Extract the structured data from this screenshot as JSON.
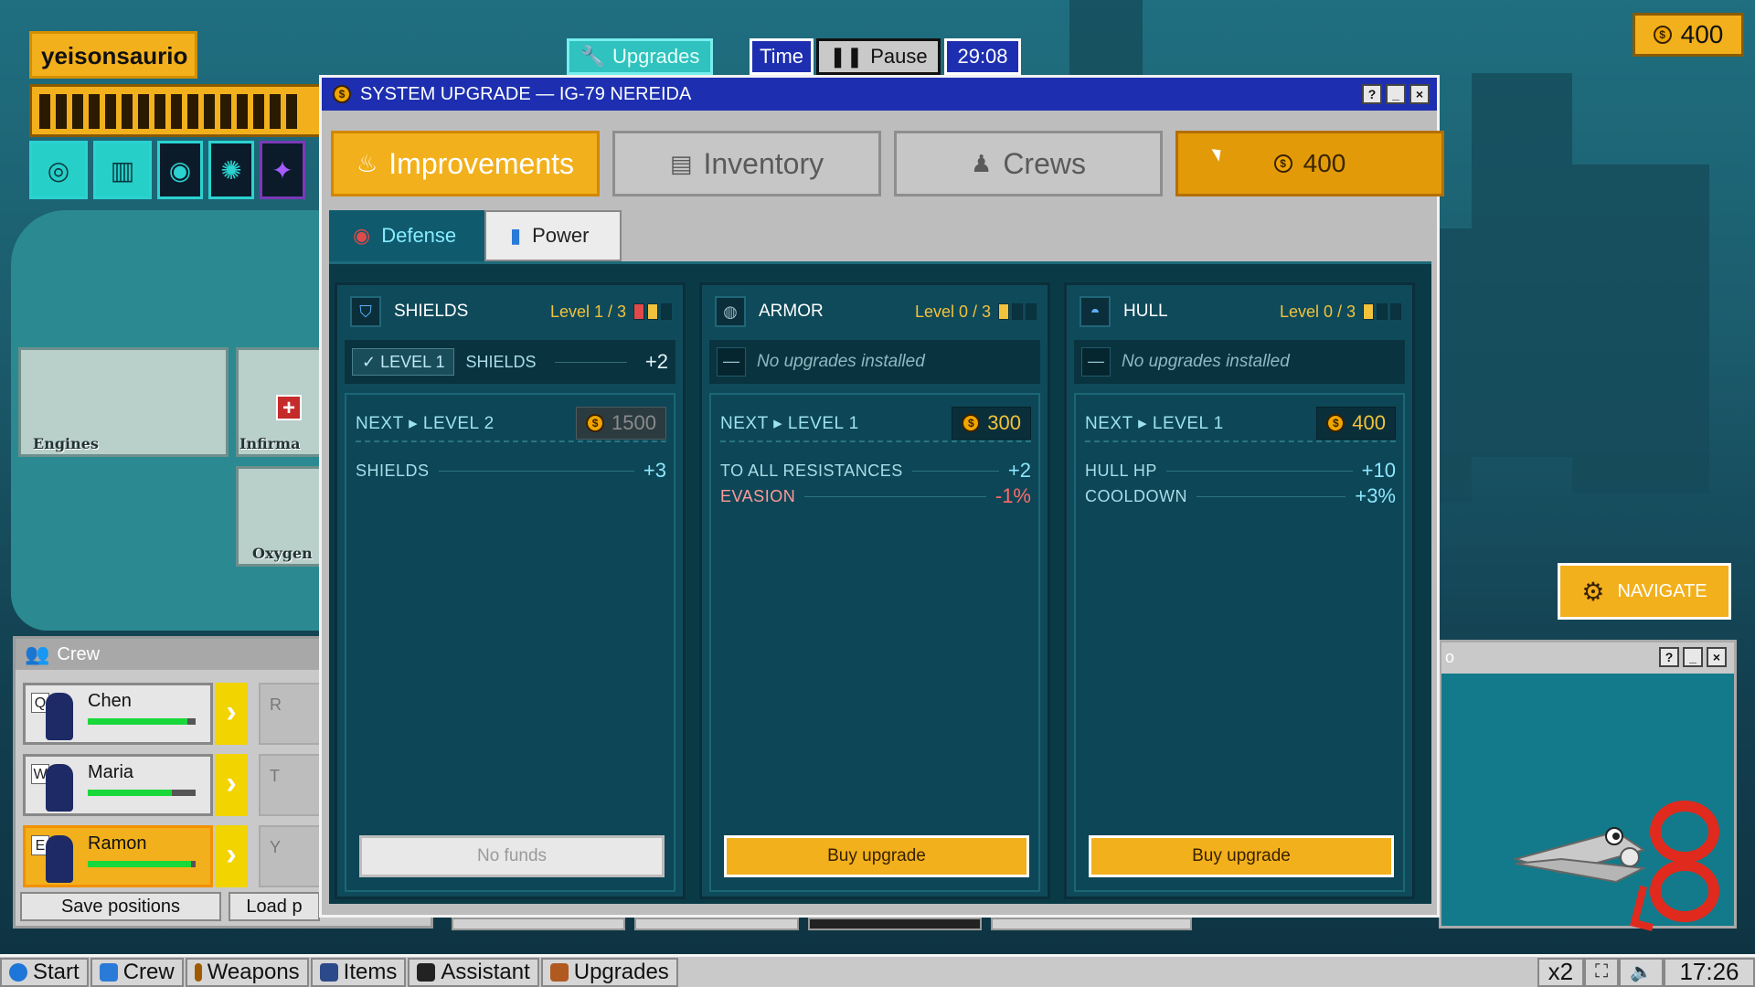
{
  "hud": {
    "player_name": "yeisonsaurio",
    "hp_segments": 16,
    "tabs": {
      "upgrades": "Upgrades",
      "time": "Time",
      "pause": "Pause",
      "clock": "29:08"
    },
    "coins": "400"
  },
  "scene": {
    "rooms": [
      "Engines",
      "Infirma",
      "Oxygen"
    ]
  },
  "dialog": {
    "title": "SYSTEM UPGRADE — IG-79 NEREIDA",
    "win_buttons": [
      "?",
      "_",
      "×"
    ],
    "main_tabs": [
      "Improvements",
      "Inventory",
      "Crews"
    ],
    "coins": "400",
    "sub_tabs": [
      "Defense",
      "Power"
    ]
  },
  "cards": [
    {
      "name": "SHIELDS",
      "level": "Level 1 / 3",
      "installed": {
        "badge": "✓ LEVEL 1",
        "name": "SHIELDS",
        "value": "+2"
      },
      "next_label": "NEXT ▸ LEVEL 2",
      "price": "1500",
      "stats": [
        {
          "name": "SHIELDS",
          "value": "+3",
          "negative": false
        }
      ],
      "button": "No funds"
    },
    {
      "name": "ARMOR",
      "level": "Level 0 / 3",
      "none_text": "No upgrades installed",
      "next_label": "NEXT ▸ LEVEL 1",
      "price": "300",
      "stats": [
        {
          "name": "TO ALL RESISTANCES",
          "value": "+2",
          "negative": false
        },
        {
          "name": "EVASION",
          "value": "-1%",
          "negative": true
        }
      ],
      "button": "Buy upgrade"
    },
    {
      "name": "HULL",
      "level": "Level 0 / 3",
      "none_text": "No upgrades installed",
      "next_label": "NEXT ▸ LEVEL 1",
      "price": "400",
      "stats": [
        {
          "name": "HULL HP",
          "value": "+10",
          "negative": false
        },
        {
          "name": "COOLDOWN",
          "value": "+3%",
          "negative": false
        }
      ],
      "button": "Buy upgrade"
    }
  ],
  "crew": {
    "title": "Crew",
    "members": [
      {
        "key": "Q",
        "name": "Chen",
        "hp": 0.92,
        "slot": "R"
      },
      {
        "key": "W",
        "name": "Maria",
        "hp": 0.78,
        "slot": "T"
      },
      {
        "key": "E",
        "name": "Ramon",
        "hp": 0.96,
        "slot": "Y"
      }
    ],
    "save_label": "Save positions",
    "load_label": "Load p"
  },
  "navigate": "NAVIGATE",
  "side_window_title": "o",
  "taskbar": {
    "start": "Start",
    "items": [
      "Crew",
      "Weapons",
      "Items",
      "Assistant",
      "Upgrades"
    ],
    "speed": "x2",
    "time": "17:26"
  },
  "colors": {
    "accent": "#f2b01c",
    "title_bar": "#1d2fb0",
    "panel": "#0f4a5a",
    "positive": "#8ce7ff",
    "negative": "#ff6a6a"
  }
}
